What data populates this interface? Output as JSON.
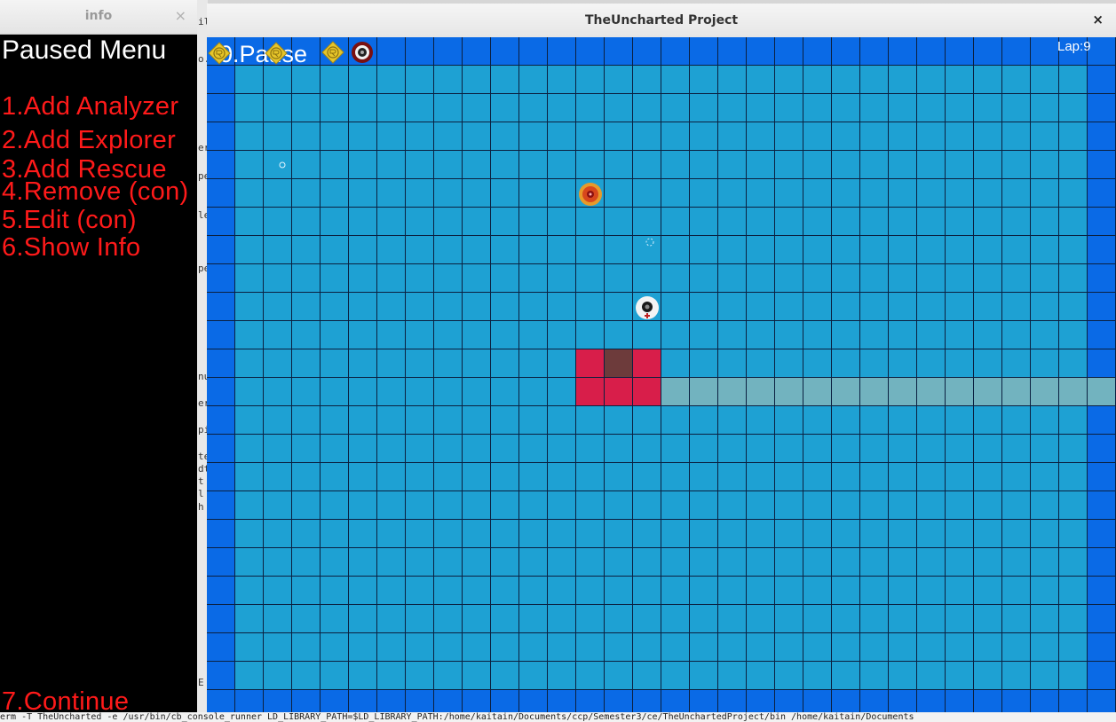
{
  "info_window": {
    "title": "info",
    "close_glyph": "×",
    "heading": "Paused Menu",
    "menu_items": [
      "1.Add Analyzer",
      "2.Add Explorer",
      "3.Add Rescue",
      "4.Remove (con)",
      "5.Edit (con)",
      "6.Show Info",
      "7.Continue"
    ]
  },
  "game_window": {
    "title": "TheUncharted Project",
    "close_glyph": "×",
    "pause_label": "0.Pause",
    "lap_label": "Lap:9",
    "grid": {
      "columns": 32,
      "rows": 24,
      "colors": {
        "border_cell": "#0a6ae6",
        "inner_cell": "#1ea1d3",
        "grid_line": "#0b2040",
        "hazard_cell": "#d81e4a",
        "dark_cell": "#6d3b3b",
        "path_cell": "#72b3bf"
      },
      "hazard_cells": [
        [
          13,
          11
        ],
        [
          15,
          11
        ],
        [
          13,
          12
        ],
        [
          14,
          12
        ],
        [
          15,
          12
        ]
      ],
      "dark_cells": [
        [
          14,
          11
        ]
      ],
      "path_cells": {
        "row": 12,
        "from_col": 16,
        "to_col": 31
      }
    },
    "sprites": [
      {
        "name": "robot-badge-icon-1"
      },
      {
        "name": "robot-badge-icon-2"
      },
      {
        "name": "robot-badge-icon-3"
      },
      {
        "name": "target-robot-icon"
      },
      {
        "name": "orange-explorer-robot-icon"
      },
      {
        "name": "white-rescue-robot-icon"
      },
      {
        "name": "small-ring-marker-icon"
      },
      {
        "name": "dashed-ring-marker-icon"
      }
    ]
  },
  "background_terminal": {
    "command_line": "erm -T TheUncharted -e /usr/bin/cb_console_runner LD_LIBRARY_PATH=$LD_LIBRARY_PATH:/home/kaitain/Documents/ccp/Semester3/ce/TheUnchartedProject/bin /home/kaitain/Documents",
    "fragments": [
      "il",
      "o.",
      "er",
      "pe",
      "le",
      "pe",
      "nu",
      "er",
      "pi",
      "te",
      "dt",
      "t",
      "l",
      "h",
      "E"
    ]
  }
}
